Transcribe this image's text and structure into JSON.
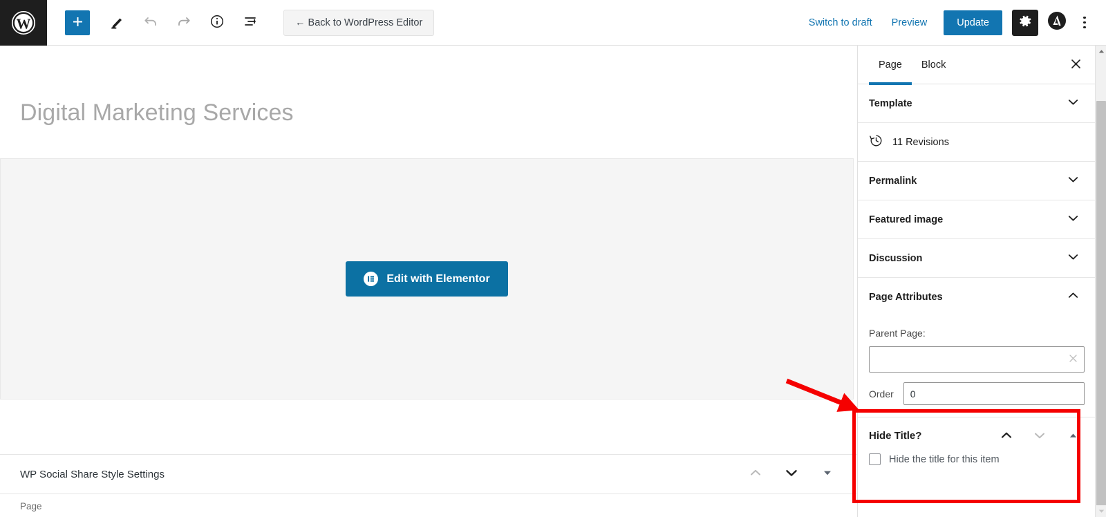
{
  "toolbar": {
    "logo_name": "WordPress",
    "add_block_label": "+",
    "tools": [
      {
        "name": "add-block",
        "label": "Add block"
      },
      {
        "name": "edit-tool",
        "label": "Tools"
      },
      {
        "name": "undo",
        "label": "Undo"
      },
      {
        "name": "redo",
        "label": "Redo"
      },
      {
        "name": "details",
        "label": "Details"
      },
      {
        "name": "list-view",
        "label": "List view"
      }
    ],
    "back_label": "← Back to WordPress Editor",
    "switch_to_draft": "Switch to draft",
    "preview": "Preview",
    "update": "Update",
    "settings_icon_label": "Settings",
    "astra_icon_label": "Astra",
    "options_icon_label": "Options"
  },
  "editor": {
    "post_title": "Digital Marketing Services",
    "elementor_button": "Edit with Elementor"
  },
  "metabox": {
    "title": "WP Social Share Style Settings",
    "breadcrumb": "Page"
  },
  "sidebar": {
    "tabs": [
      {
        "label": "Page",
        "active": true
      },
      {
        "label": "Block",
        "active": false
      }
    ],
    "close_label": "Close settings",
    "sections": [
      {
        "label": "Template",
        "expanded": false
      },
      {
        "label": "Permalink",
        "expanded": false
      },
      {
        "label": "Featured image",
        "expanded": false
      },
      {
        "label": "Discussion",
        "expanded": false
      },
      {
        "label": "Page Attributes",
        "expanded": true
      }
    ],
    "revisions": "11 Revisions",
    "page_attributes": {
      "parent_label": "Parent Page:",
      "parent_value": "",
      "order_label": "Order",
      "order_value": "0"
    },
    "hide_title": {
      "label": "Hide Title?",
      "checkbox_label": "Hide the title for this item",
      "checked": false
    }
  },
  "colors": {
    "accent": "#1275b1",
    "elementor": "#0c71a3",
    "annotation": "#f50000",
    "dark": "#1e1e1e"
  }
}
